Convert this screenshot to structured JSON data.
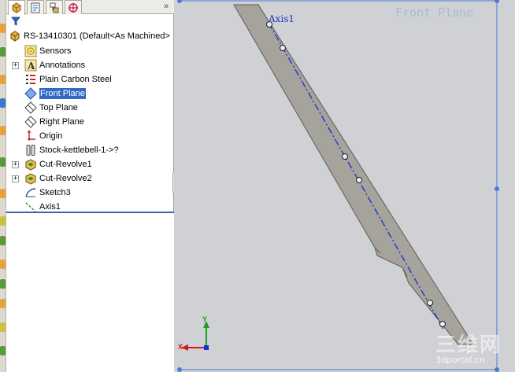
{
  "fm_tree": {
    "root": {
      "label": "RS-13410301  (Default<As Machined>"
    },
    "items": [
      {
        "label": "Sensors",
        "icon": "sensors-icon",
        "expandable": false
      },
      {
        "label": "Annotations",
        "icon": "annotations-icon",
        "expandable": true
      },
      {
        "label": "Plain Carbon Steel",
        "icon": "material-icon",
        "expandable": false
      },
      {
        "label": "Front Plane",
        "icon": "plane-icon",
        "expandable": false,
        "selected": true
      },
      {
        "label": "Top Plane",
        "icon": "plane-icon",
        "expandable": false
      },
      {
        "label": "Right Plane",
        "icon": "plane-icon",
        "expandable": false
      },
      {
        "label": "Origin",
        "icon": "origin-icon",
        "expandable": false
      },
      {
        "label": "Stock-kettlebell-1->?",
        "icon": "stock-icon",
        "expandable": false
      },
      {
        "label": "Cut-Revolve1",
        "icon": "cut-revolve-icon",
        "expandable": true
      },
      {
        "label": "Cut-Revolve2",
        "icon": "cut-revolve-icon",
        "expandable": true
      },
      {
        "label": "Sketch3",
        "icon": "sketch-icon",
        "expandable": false
      },
      {
        "label": "Axis1",
        "icon": "axis-icon",
        "expandable": false
      }
    ],
    "tabs_overflow": "»"
  },
  "viewport": {
    "plane_label": "Front Plane",
    "axis_label": "Axis1",
    "triad": {
      "x_label": "X",
      "y_label": "Y"
    },
    "watermark": {
      "text": "三维网",
      "url": "3dportal.cn"
    }
  },
  "colors": {
    "selection": "#316ac5",
    "plane_border": "#4a7ad6",
    "axis_line": "#1530d8",
    "part_face": "#a6a39c",
    "viewport_bg": "#cfd1d5"
  }
}
